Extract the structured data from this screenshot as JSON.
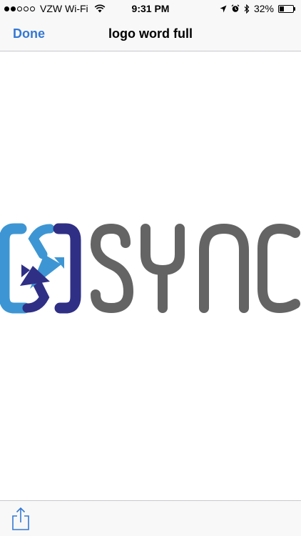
{
  "status_bar": {
    "carrier": "VZW Wi-Fi",
    "time": "9:31 PM",
    "battery_percent": "32%",
    "battery_level": 0.32,
    "signal_bars_filled": 2,
    "signal_bars_total": 5
  },
  "nav": {
    "done_label": "Done",
    "title": "logo word full"
  },
  "image": {
    "logo_text": "SYNC",
    "colors": {
      "logo_text": "#646464",
      "icon_light_blue": "#3d96d3",
      "icon_dark_blue": "#2f2f86",
      "accent": "#3478d4"
    }
  },
  "toolbar": {
    "share_icon": "share-icon"
  }
}
